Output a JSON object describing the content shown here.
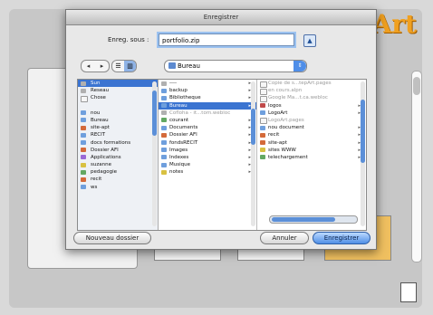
{
  "background": {
    "brand_text": "Art"
  },
  "dialog": {
    "title": "Enregistrer",
    "save_as_label": "Enreg. sous :",
    "filename_value": "portfolio.zip",
    "location": "Bureau",
    "new_folder_label": "Nouveau dossier",
    "cancel_label": "Annuler",
    "save_label": "Enregistrer"
  },
  "sidebar": {
    "items": [
      {
        "label": "Sun",
        "icon": "disk-icon",
        "selected": true,
        "color": "b2"
      },
      {
        "label": "Reseau",
        "icon": "network-icon",
        "selected": false,
        "color": "b2"
      },
      {
        "label": "Chose",
        "icon": "folder-icon",
        "selected": false,
        "color": "b8"
      },
      {
        "label": "",
        "icon": "spacer",
        "selected": false,
        "color": ""
      },
      {
        "label": "nou",
        "icon": "folder-icon",
        "selected": false,
        "color": "b1"
      },
      {
        "label": "Bureau",
        "icon": "desktop-icon",
        "selected": false,
        "color": "b1"
      },
      {
        "label": "site-apt",
        "icon": "folder-icon",
        "selected": false,
        "color": "b3"
      },
      {
        "label": "RECIT",
        "icon": "folder-icon",
        "selected": false,
        "color": "b1"
      },
      {
        "label": "docs formations",
        "icon": "folder-icon",
        "selected": false,
        "color": "b1"
      },
      {
        "label": "Dossier AFI",
        "icon": "folder-icon",
        "selected": false,
        "color": "b3"
      },
      {
        "label": "Applications",
        "icon": "applications-icon",
        "selected": false,
        "color": "b4"
      },
      {
        "label": "suzanne",
        "icon": "home-icon",
        "selected": false,
        "color": "b6"
      },
      {
        "label": "pedagogie",
        "icon": "folder-icon",
        "selected": false,
        "color": "b5"
      },
      {
        "label": "recit",
        "icon": "folder-icon",
        "selected": false,
        "color": "b3"
      },
      {
        "label": "ws",
        "icon": "folder-icon",
        "selected": false,
        "color": "b1"
      }
    ]
  },
  "column1": {
    "items": [
      {
        "label": "----",
        "has_children": true,
        "selected": false,
        "dim": false,
        "color": "b2"
      },
      {
        "label": "backup",
        "has_children": true,
        "selected": false,
        "dim": false,
        "color": "b1"
      },
      {
        "label": "Bibliotheque",
        "has_children": true,
        "selected": false,
        "dim": false,
        "color": "b1"
      },
      {
        "label": "Bureau",
        "has_children": true,
        "selected": true,
        "dim": false,
        "color": "b1"
      },
      {
        "label": "Cofloha - it...tom.webloc",
        "has_children": false,
        "selected": false,
        "dim": true,
        "color": "b2"
      },
      {
        "label": "courant",
        "has_children": true,
        "selected": false,
        "dim": false,
        "color": "b5"
      },
      {
        "label": "Documents",
        "has_children": true,
        "selected": false,
        "dim": false,
        "color": "b1"
      },
      {
        "label": "Dossier AFI",
        "has_children": true,
        "selected": false,
        "dim": false,
        "color": "b3"
      },
      {
        "label": "fondsRECIT",
        "has_children": true,
        "selected": false,
        "dim": false,
        "color": "b1"
      },
      {
        "label": "Images",
        "has_children": true,
        "selected": false,
        "dim": false,
        "color": "b1"
      },
      {
        "label": "Indexes",
        "has_children": true,
        "selected": false,
        "dim": false,
        "color": "b1"
      },
      {
        "label": "Musique",
        "has_children": true,
        "selected": false,
        "dim": false,
        "color": "b1"
      },
      {
        "label": "notes",
        "has_children": true,
        "selected": false,
        "dim": false,
        "color": "b6"
      }
    ]
  },
  "column2": {
    "items": [
      {
        "label": "Copie de s...tepArt.pages",
        "has_children": false,
        "dim": true,
        "color": "b8"
      },
      {
        "label": "en cours.alpn",
        "has_children": false,
        "dim": true,
        "color": "b8"
      },
      {
        "label": "Google Ma...t.ca.webloc",
        "has_children": false,
        "dim": true,
        "color": "b8"
      },
      {
        "label": "logos",
        "has_children": true,
        "dim": false,
        "color": "b7"
      },
      {
        "label": "LogoArt",
        "has_children": true,
        "dim": false,
        "color": "b1"
      },
      {
        "label": "LogoArt.pages",
        "has_children": false,
        "dim": true,
        "color": "b8"
      },
      {
        "label": "nou document",
        "has_children": true,
        "dim": false,
        "color": "b1"
      },
      {
        "label": "recit",
        "has_children": true,
        "dim": false,
        "color": "b3"
      },
      {
        "label": "site-apt",
        "has_children": true,
        "dim": false,
        "color": "b3"
      },
      {
        "label": "sites WWW",
        "has_children": true,
        "dim": false,
        "color": "b6"
      },
      {
        "label": "telechargement",
        "has_children": true,
        "dim": false,
        "color": "b5"
      }
    ]
  }
}
